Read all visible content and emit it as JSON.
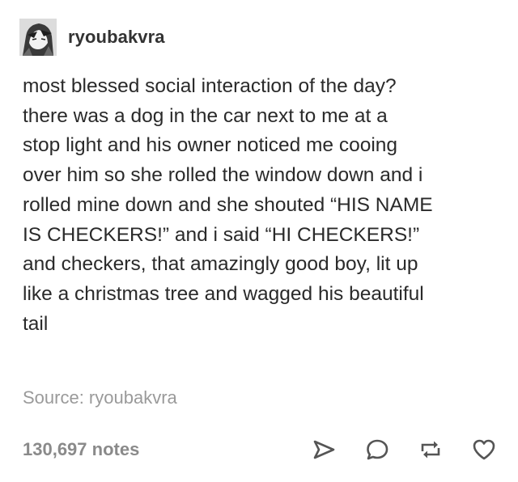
{
  "post": {
    "username": "ryoubakvra",
    "lines": [
      "most blessed social interaction of the day?",
      "there was a dog in the car next to me at a",
      "stop light and his owner noticed me cooing",
      "over him so she rolled the window down and i",
      "rolled mine down and she shouted “HIS NAME",
      "IS CHECKERS!” and i said “HI CHECKERS!”",
      "and checkers, that amazingly good boy, lit up",
      "like a christmas tree and wagged his beautiful",
      "tail"
    ],
    "source": "Source: ryoubakvra",
    "notes": "130,697 notes"
  },
  "icons": {
    "share": "share-icon",
    "reply": "reply-icon",
    "reblog": "reblog-icon",
    "like": "heart-icon"
  },
  "colors": {
    "text": "#2a2a2a",
    "muted": "#9a9a9a",
    "notes": "#8a8a8a",
    "icon": "#555555"
  }
}
